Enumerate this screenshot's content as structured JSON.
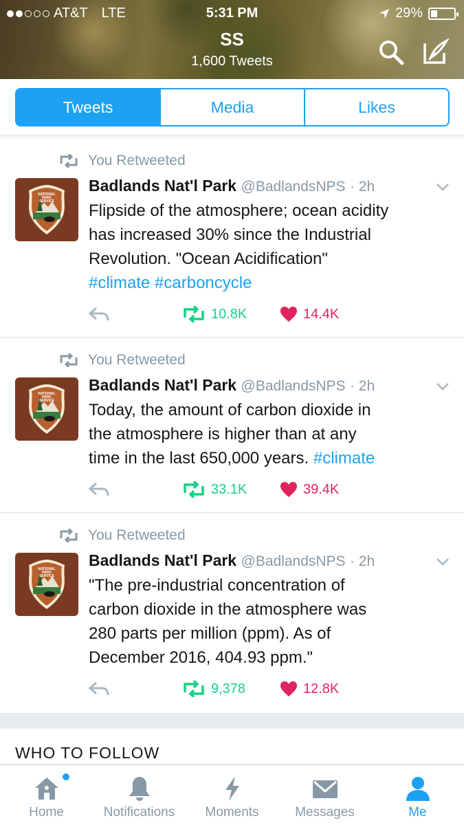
{
  "status_bar": {
    "carrier": "AT&T",
    "network": "LTE",
    "time": "5:31 PM",
    "battery": "29%",
    "battery_level": 0.29,
    "signal_bars": 2
  },
  "profile": {
    "name": "SS",
    "tweet_count": "1,600 Tweets"
  },
  "tabs": [
    {
      "label": "Tweets",
      "active": true
    },
    {
      "label": "Media",
      "active": false
    },
    {
      "label": "Likes",
      "active": false
    }
  ],
  "tweets": [
    {
      "retweet_label": "You Retweeted",
      "name": "Badlands Nat'l Park",
      "handle": "@BadlandsNPS",
      "time": "· 2h",
      "text_lines": [
        "Flipside of the atmosphere; ocean acidity",
        "has increased 30% since the Industrial",
        "Revolution. \"Ocean Acidification\""
      ],
      "hashtag_line": "#climate #carboncycle",
      "retweets": "10.8K",
      "likes": "14.4K"
    },
    {
      "retweet_label": "You Retweeted",
      "name": "Badlands Nat'l Park",
      "handle": "@BadlandsNPS",
      "time": "· 2h",
      "text_lines": [
        "Today, the amount of carbon dioxide in",
        "the atmosphere is higher than at any",
        "time in the last 650,000 years."
      ],
      "hashtag_inline": "#climate",
      "retweets": "33.1K",
      "likes": "39.4K"
    },
    {
      "retweet_label": "You Retweeted",
      "name": "Badlands Nat'l Park",
      "handle": "@BadlandsNPS",
      "time": "· 2h",
      "text_lines": [
        "\"The pre-industrial concentration of",
        "carbon dioxide in the atmosphere was",
        "280 parts per million (ppm). As of",
        "December 2016, 404.93 ppm.\""
      ],
      "retweets": "9,378",
      "likes": "12.8K"
    }
  ],
  "who_to_follow": "WHO TO FOLLOW",
  "bottom_nav": [
    {
      "label": "Home",
      "icon": "home-icon"
    },
    {
      "label": "Notifications",
      "icon": "bell-icon"
    },
    {
      "label": "Moments",
      "icon": "lightning-icon"
    },
    {
      "label": "Messages",
      "icon": "envelope-icon"
    },
    {
      "label": "Me",
      "icon": "person-icon",
      "active": true
    }
  ],
  "colors": {
    "accent": "#1da1f2",
    "retweet": "#19cf86",
    "like": "#e0245e",
    "muted": "#8899a6",
    "avatar_brown": "#7a3a22"
  }
}
